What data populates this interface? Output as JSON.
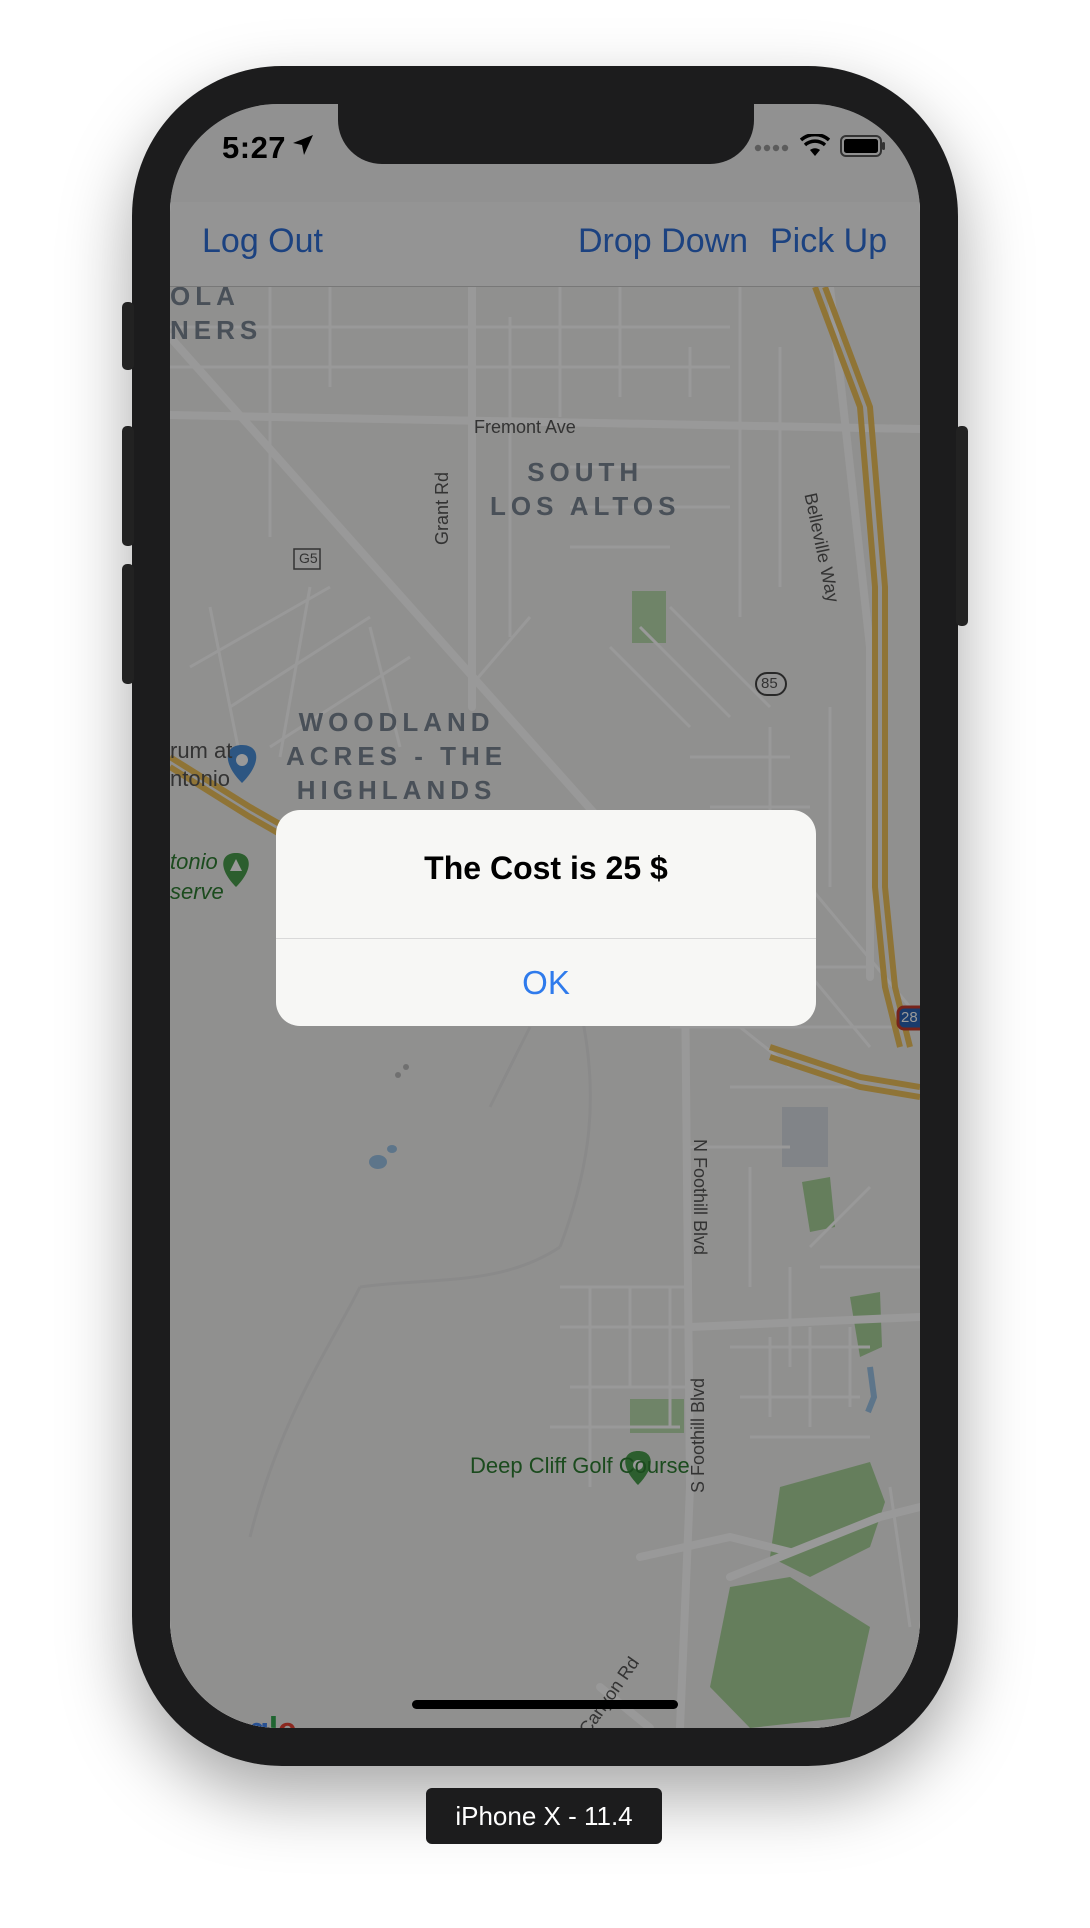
{
  "status_bar": {
    "time": "5:27",
    "location_icon": "location-arrow-icon",
    "signal_icon": "cellular-signal-icon",
    "wifi_icon": "wifi-icon",
    "battery_icon": "battery-icon"
  },
  "nav_bar": {
    "log_out_label": "Log Out",
    "drop_down_label": "Drop Down",
    "pick_up_label": "Pick Up",
    "tint_color": "#2f6fd6"
  },
  "map": {
    "area_labels": [
      "OLA\nNERS",
      "SOUTH\nLOS ALTOS",
      "WOODLAND\nACRES - THE\nHIGHLANDS"
    ],
    "road_labels": [
      "Fremont Ave",
      "Grant Rd",
      "Belleville Way",
      "N Foothill Blvd",
      "S Foothill Blvd",
      "Canyon Rd"
    ],
    "shields": [
      "G5",
      "85",
      "28"
    ],
    "poi_labels": [
      "rum at\nntonio",
      "tonio\nserve",
      "Deep Cliff Golf Course"
    ],
    "attribution": "Google"
  },
  "alert": {
    "title": "The Cost is 25 $",
    "ok_label": "OK",
    "button_color": "#2f7bec"
  },
  "device_label": "iPhone X - 11.4"
}
